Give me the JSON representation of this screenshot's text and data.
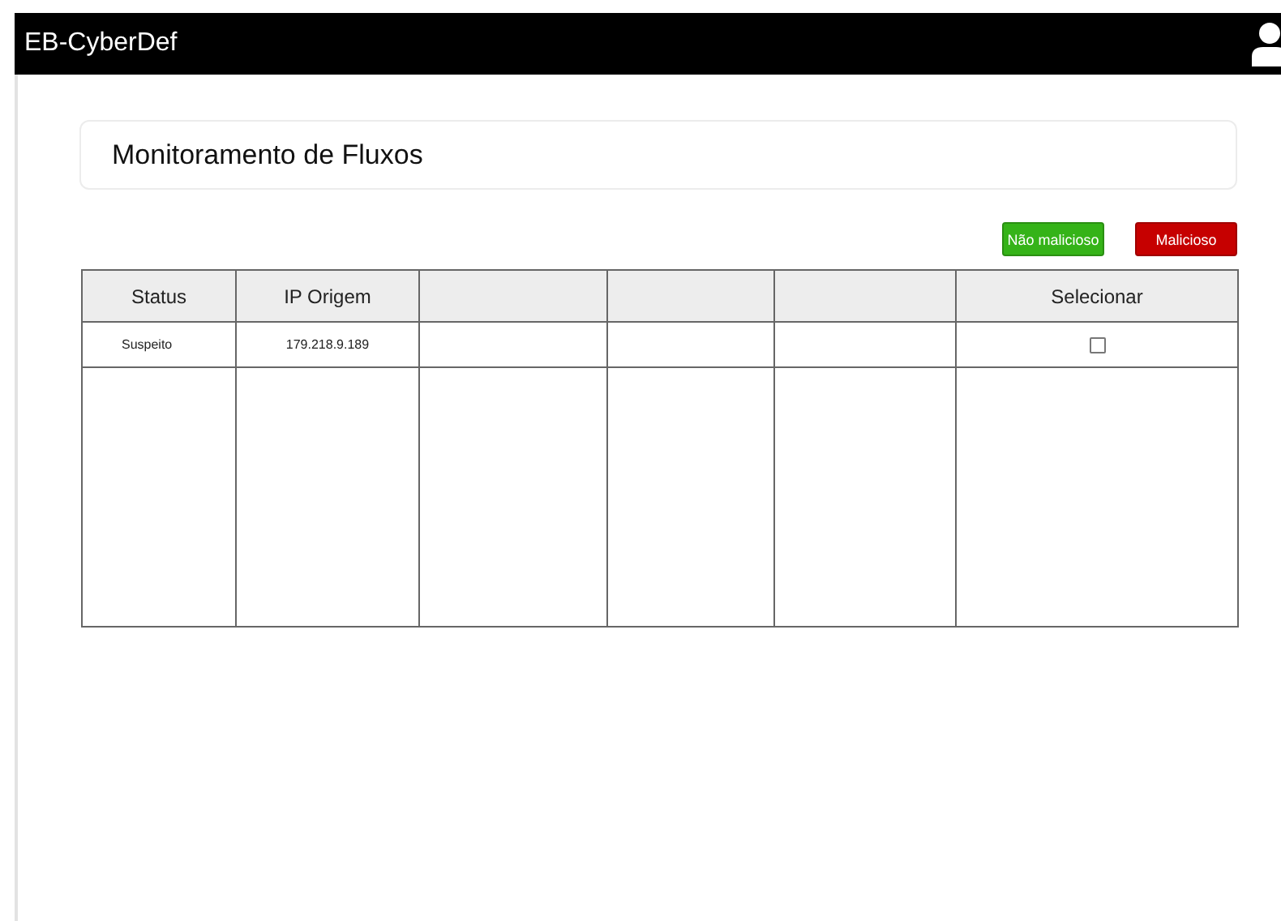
{
  "header": {
    "title": "EB-CyberDef"
  },
  "page_title": "Monitoramento de Fluxos",
  "actions": [
    {
      "label": "Não malicioso",
      "kind": "benign"
    },
    {
      "label": "Malicioso",
      "kind": "malicious"
    }
  ],
  "table": {
    "columns": [
      {
        "label": "Status"
      },
      {
        "label": "IP Origem"
      },
      {},
      {},
      {},
      {
        "label": "Selecionar"
      }
    ],
    "rows": [
      {
        "status": "Suspeito",
        "ip_origem": "179.218.9.189",
        "checked": false
      }
    ]
  }
}
